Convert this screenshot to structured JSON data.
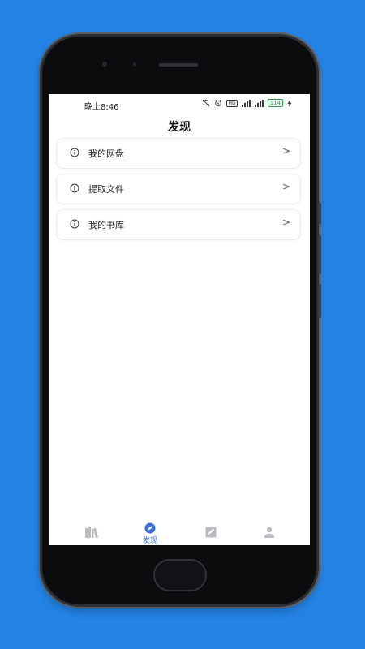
{
  "status_bar": {
    "time": "晚上8:46",
    "network_badge": "HD",
    "battery": "114"
  },
  "page": {
    "title": "发现"
  },
  "menu": [
    {
      "label": "我的网盘",
      "chevron": ">"
    },
    {
      "label": "提取文件",
      "chevron": ">"
    },
    {
      "label": "我的书库",
      "chevron": ">"
    }
  ],
  "tab_bar": {
    "active_label": "发现",
    "accent_color": "#3a6fd8"
  }
}
